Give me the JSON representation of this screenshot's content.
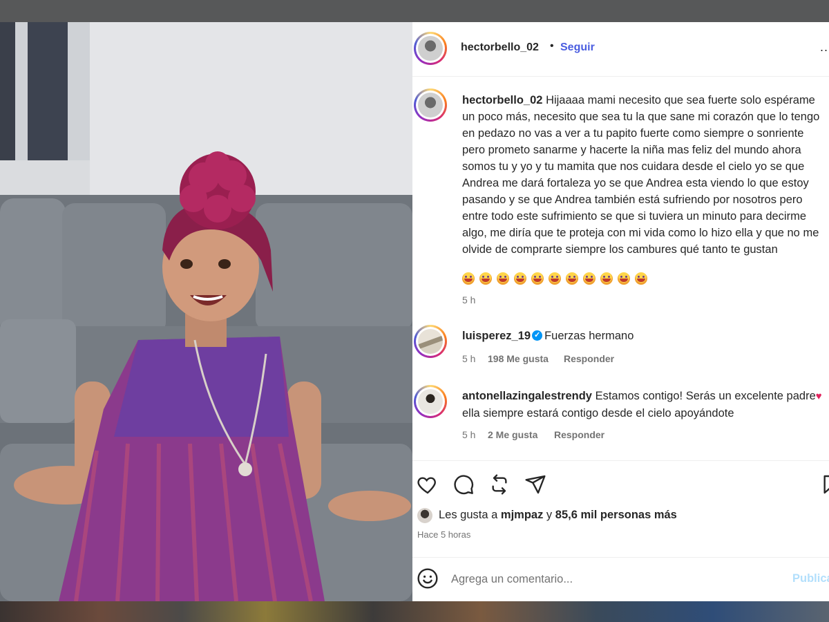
{
  "post": {
    "username": "hectorbello_02",
    "dot": "•",
    "follow_label": "Seguir",
    "more_label": "...",
    "caption": "Hijaaaa mami necesito que sea fuerte solo espérame un poco más, necesito que sea tu la que sane mi corazón que lo tengo en pedazo no vas a ver a tu papito fuerte como siempre o sonriente pero prometo sanarme y hacerte la niña mas feliz del mundo ahora somos tu y yo y tu mamita que nos cuidara desde el cielo yo se que Andrea me dará fortaleza yo se que Andrea esta viendo lo que estoy pasando y se que Andrea también está sufriendo por nosotros pero entre todo este sufrimiento se que si tuviera un minuto para decirme algo, me diría que te proteja con mi vida como lo hizo ella y que no me olvide de comprarte siempre los cambures qué tanto te gustan",
    "caption_emoji": "crying-face",
    "caption_emoji_count": 11,
    "caption_time": "5 h"
  },
  "comments": [
    {
      "username": "luisperez_19",
      "verified": true,
      "text": "Fuerzas hermano",
      "time": "5 h",
      "likes": "198 Me gusta",
      "reply": "Responder"
    },
    {
      "username": "antonellazingalestrendy",
      "verified": false,
      "text_before": "Estamos contigo! Serás un excelente padre",
      "heart": "♥",
      "text_after": " ella siempre estará contigo desde el cielo apoyándote",
      "time": "5 h",
      "likes": "2 Me gusta",
      "reply": "Responder"
    }
  ],
  "actions": {
    "icons": [
      "heart-icon",
      "comment-icon",
      "repost-icon",
      "share-icon",
      "bookmark-icon"
    ]
  },
  "likes": {
    "prefix": "Les gusta a ",
    "user": "mjmpaz",
    "middle": " y ",
    "others": "85,6 mil personas más"
  },
  "posted_time": "Hace 5 horas",
  "comment_box": {
    "placeholder": "Agrega un comentario...",
    "publish_label": "Publicar"
  },
  "colors": {
    "link_blue": "#4a5de0",
    "verified_blue": "#0095f6",
    "publish_disabled": "#b2dffc",
    "meta_gray": "#737373"
  }
}
